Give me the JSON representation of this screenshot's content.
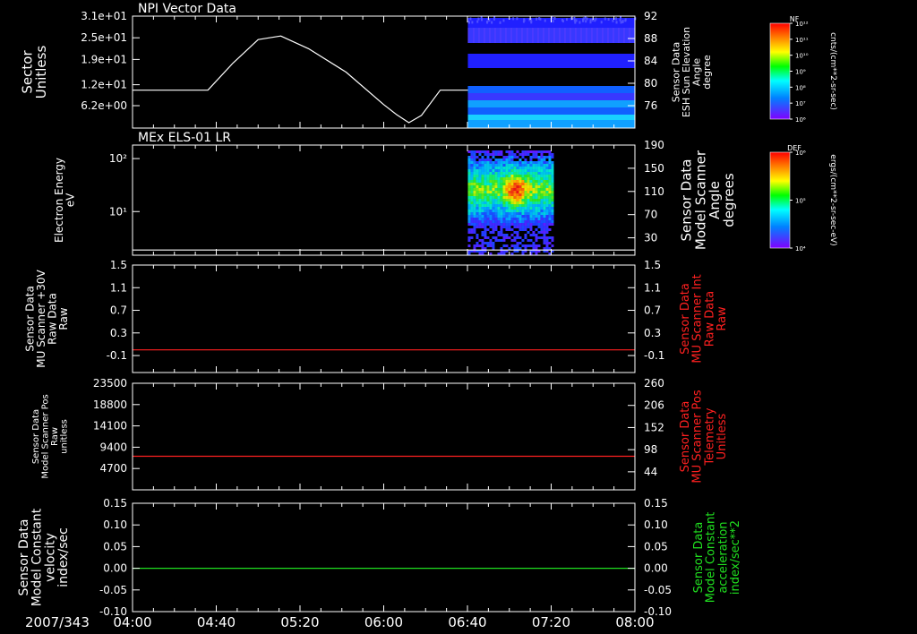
{
  "colors": {
    "background": "#000000",
    "axis": "#ffffff",
    "red": "#ff2020",
    "green": "#20e020",
    "white": "#ffffff"
  },
  "time_axis": {
    "date_label": "2007/343",
    "ticks": [
      "04:00",
      "04:40",
      "05:20",
      "06:00",
      "06:40",
      "07:20",
      "08:00"
    ],
    "start_hours": 4,
    "end_hours": 8
  },
  "colorbars": [
    {
      "label": "NF",
      "unit": "cnts/(cm**2-sr-sec)",
      "ticks": [
        "10¹²",
        "10¹¹",
        "10¹⁰",
        "10⁹",
        "10⁸",
        "10⁷",
        "10⁶"
      ]
    },
    {
      "label": "DEF",
      "unit": "ergs/(cm**2-sr-sec-eV)",
      "ticks": [
        "10⁶",
        "10⁵",
        "10⁴"
      ]
    }
  ],
  "chart_data": [
    {
      "type": "line",
      "title": "NPI Vector Data",
      "ylabel": "Sector\nUnitless",
      "yticks": [
        "3.1e+01",
        "2.5e+01",
        "1.9e+01",
        "1.2e+01",
        "6.2e+00"
      ],
      "ytick_values": [
        31,
        25,
        19,
        12,
        6.2
      ],
      "ylim": [
        0,
        31
      ],
      "right_ylabel": "Sensor Data\nESH Sun Elevation\nAngle\ndegree",
      "right_yticks": [
        "92",
        "88",
        "84",
        "80",
        "76"
      ],
      "right_ytick_values": [
        92,
        88,
        84,
        80,
        76
      ],
      "right_ylim": [
        72,
        92
      ],
      "series": [
        {
          "color": "white",
          "x": [
            4.0,
            4.6,
            4.8,
            5.0,
            5.18,
            5.4,
            5.7,
            6.0,
            6.1,
            6.2,
            6.3,
            6.45,
            6.67
          ],
          "y": [
            10.5,
            10.5,
            18,
            24.5,
            25.5,
            22,
            15.5,
            6.5,
            3.8,
            1.5,
            3.5,
            10.5,
            10.5
          ]
        }
      ],
      "spectrogram": {
        "x_start": 6.67,
        "x_end": 8.0,
        "colors": [
          "#2020ff",
          "#3838ff",
          "#1060ff",
          "#10a0ff",
          "#18d0ff"
        ]
      }
    },
    {
      "type": "heatmap",
      "title": "MEx ELS-01 LR",
      "ylabel": "Electron Energy\neV",
      "yticks": [
        "10²",
        "10¹"
      ],
      "ytick_values": [
        100,
        10
      ],
      "yscale": "log",
      "ylim": [
        1.5,
        180
      ],
      "right_ylabel": "Sensor Data\nModel Scanner\nAngle\ndegrees",
      "right_yticks": [
        "190",
        "150",
        "110",
        "70",
        "30"
      ],
      "right_ytick_values": [
        190,
        150,
        110,
        70,
        30
      ],
      "right_ylim": [
        0,
        190
      ],
      "series": [
        {
          "color": "white",
          "x": [
            4.0,
            8.0
          ],
          "right_y": [
            9,
            9
          ]
        }
      ],
      "spectrogram": {
        "x_start": 6.67,
        "x_end": 7.35
      }
    },
    {
      "type": "line",
      "ylabel": "Sensor Data\nMU Scanner +30V\nRaw Data\nRaw",
      "yticks": [
        "1.5",
        "1.1",
        "0.7",
        "0.3",
        "-0.1"
      ],
      "ytick_values": [
        1.5,
        1.1,
        0.7,
        0.3,
        -0.1
      ],
      "ylim": [
        -0.4,
        1.5
      ],
      "right_ylabel": "Sensor Data\nMU Scanner Int\nRaw Data\nRaw",
      "right_yticks": [
        "1.5",
        "1.1",
        "0.7",
        "0.3",
        "-0.1"
      ],
      "right_ytick_values": [
        1.5,
        1.1,
        0.7,
        0.3,
        -0.1
      ],
      "right_ylim": [
        -0.4,
        1.5
      ],
      "right_color": "red",
      "series": [
        {
          "color": "red",
          "x": [
            4.0,
            8.0
          ],
          "y": [
            0.0,
            0.0
          ]
        }
      ]
    },
    {
      "type": "line",
      "ylabel": "Sensor Data\nModel Scanner Pos\nRaw\nunitless",
      "yticks": [
        "23500",
        "18800",
        "14100",
        "9400",
        "4700"
      ],
      "ytick_values": [
        23500,
        18800,
        14100,
        9400,
        4700
      ],
      "ylim": [
        0,
        23500
      ],
      "right_ylabel": "Sensor Data\nMU Scanner Pos\nTelemetry\nUnitless",
      "right_yticks": [
        "260",
        "206",
        "152",
        "98",
        "44"
      ],
      "right_ytick_values": [
        260,
        206,
        152,
        98,
        44
      ],
      "right_ylim": [
        0,
        260
      ],
      "right_color": "red",
      "series": [
        {
          "color": "red",
          "x": [
            4.0,
            8.0
          ],
          "right_y": [
            82,
            82
          ]
        }
      ]
    },
    {
      "type": "line",
      "ylabel": "Sensor Data\nModel Constant\nvelocity\nindex/sec",
      "yticks": [
        "0.15",
        "0.10",
        "0.05",
        "0.00",
        "-0.05",
        "-0.10"
      ],
      "ytick_values": [
        0.15,
        0.1,
        0.05,
        0.0,
        -0.05,
        -0.1
      ],
      "ylim": [
        -0.1,
        0.15
      ],
      "right_ylabel": "Sensor Data\nModel Constant\nacceleration\nindex/sec**2",
      "right_yticks": [
        "0.15",
        "0.10",
        "0.05",
        "0.00",
        "-0.05",
        "-0.10"
      ],
      "right_ytick_values": [
        0.15,
        0.1,
        0.05,
        0.0,
        -0.05,
        -0.1
      ],
      "right_ylim": [
        -0.1,
        0.15
      ],
      "right_color": "green",
      "series": [
        {
          "color": "green",
          "x": [
            4.0,
            8.0
          ],
          "y": [
            0.0,
            0.0
          ]
        }
      ]
    }
  ]
}
